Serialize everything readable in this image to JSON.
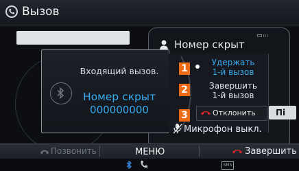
{
  "header": {
    "title": "Вызов",
    "icon": "phone-circle-icon"
  },
  "call_panel": {
    "caller_name": "Номер скрыт",
    "status_icons": "▭ᵢₗₗ",
    "mic_status": "Микрофон выкл."
  },
  "popup": {
    "incoming_text": "Входящий вызов.",
    "caller_name": "Номер скрыт",
    "caller_number": "000000000"
  },
  "options": [
    {
      "number": "1",
      "label": "Удержать\n1-й вызов",
      "selected": true
    },
    {
      "number": "2",
      "label": "Завершить\n1-й вызов",
      "selected": false
    },
    {
      "number": "3",
      "label": "Отклонить",
      "selected": false
    }
  ],
  "answer_button_label": "Пі",
  "bottom_bar": {
    "call_label": "Позвонить",
    "menu_label": "МЕНЮ",
    "end_label": "Завершить"
  },
  "status_bar": {
    "sms_icon_text": "SMS"
  },
  "colors": {
    "accent_blue": "#37a9ee",
    "option_orange": "#ee6a13",
    "reject_red": "#e0242a"
  }
}
